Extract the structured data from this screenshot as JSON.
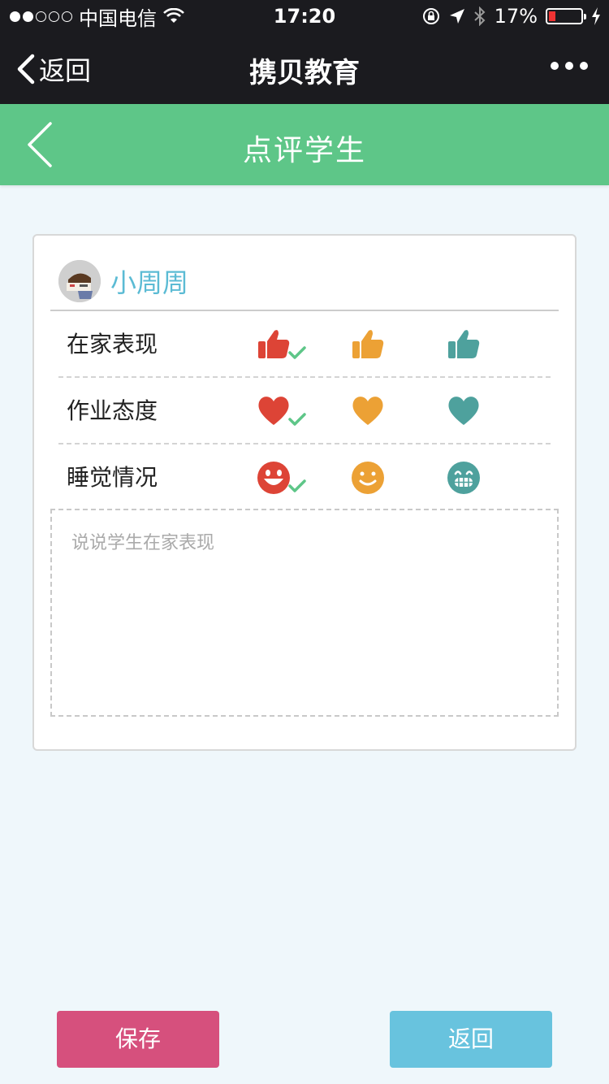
{
  "status_bar": {
    "carrier": "中国电信",
    "time": "17:20",
    "battery_percent": "17%",
    "signal_bars": 2,
    "icons": [
      "wifi-icon",
      "orientation-lock-icon",
      "location-icon",
      "bluetooth-icon",
      "battery-icon",
      "charging-icon"
    ]
  },
  "wechat_nav": {
    "back_label": "返回",
    "title": "携贝教育",
    "more_icon": "more-dots-icon"
  },
  "header": {
    "title": "点评学生",
    "back_icon": "chevron-left-icon",
    "color": "#5ec688"
  },
  "student": {
    "name": "小周周",
    "name_color": "#5bbbd4"
  },
  "evaluation": {
    "rows": [
      {
        "label": "在家表现",
        "icon": "thumbs-up-icon",
        "selected": 0
      },
      {
        "label": "作业态度",
        "icon": "heart-icon",
        "selected": 0
      },
      {
        "label": "睡觉情况",
        "icon": "smiley-icon",
        "selected": 0
      }
    ],
    "option_colors": [
      "#dd4436",
      "#eca135",
      "#4ea19d"
    ],
    "check_color": "#5ec688"
  },
  "comment": {
    "placeholder": "说说学生在家表现",
    "value": ""
  },
  "buttons": {
    "save_label": "保存",
    "back_label": "返回",
    "save_color": "#d6507d",
    "back_color": "#68c3de"
  }
}
